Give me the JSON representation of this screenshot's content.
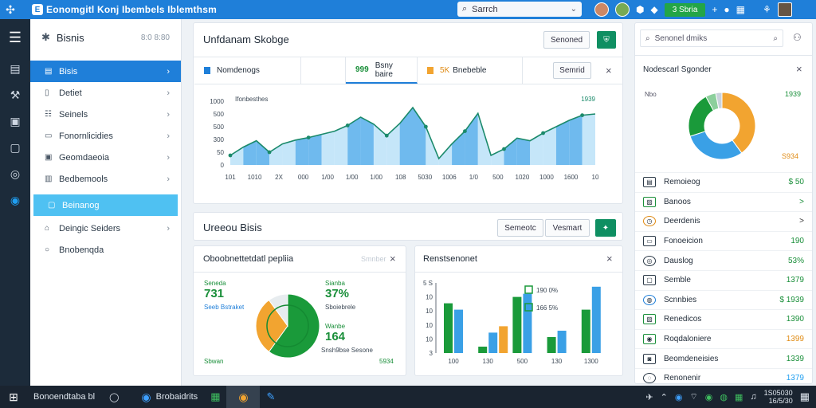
{
  "titlebar": {
    "badge": "E",
    "title": "Eonomgitl Konj Ibembels Iblemthsm",
    "search_value": "Sarrch"
  },
  "topbar": {
    "green_button": "3 Sbria"
  },
  "sidebar": {
    "title": "Bisnis",
    "count": "8:0 8:80",
    "items": [
      {
        "label": "Bisis"
      },
      {
        "label": "Detiet"
      },
      {
        "label": "Seinels"
      },
      {
        "label": "Fonornlicidies"
      },
      {
        "label": "Geomdaeoia"
      },
      {
        "label": "Bedbemools"
      },
      {
        "label": "Beinanog"
      },
      {
        "label": "Deingic Seiders"
      },
      {
        "label": "Bnobenqda"
      }
    ]
  },
  "panel_top": {
    "title": "Unfdanam Skobge",
    "btn_label": "Senoned",
    "tabs": [
      {
        "label": "Nomdenogs"
      },
      {
        "label": "Bsny baire",
        "prefix": "999"
      },
      {
        "label": "Bnebeble",
        "prefix": "5K"
      }
    ],
    "tab_button": "Semrid"
  },
  "main_chart": {
    "chart_data": {
      "type": "line",
      "annotation_left": "Ifonbesthes",
      "annotation_right": "1939",
      "y_ticks": [
        "1000",
        "500",
        "500",
        "300",
        "50",
        "0"
      ],
      "x_ticks": [
        "101",
        "1010",
        "2X",
        "000",
        "1/00",
        "1/00",
        "1/00",
        "108",
        "5030",
        "1006",
        "1/0",
        "500",
        "1020",
        "1000",
        "1600",
        "10"
      ],
      "ylim": [
        0,
        1000
      ],
      "series": [
        {
          "values": [
            150,
            280,
            380,
            200,
            330,
            390,
            430,
            480,
            530,
            620,
            750,
            640,
            460,
            650,
            900,
            600,
            100,
            330,
            530,
            810,
            150,
            250,
            420,
            380,
            500,
            600,
            700,
            780,
            800
          ]
        }
      ]
    }
  },
  "panel_mid": {
    "title": "Ureeou Bisis",
    "btn1": "Semeotc",
    "btn2": "Vesmart"
  },
  "panel_pie": {
    "title": "Oboobnettetdatl pepliia",
    "header_right": "Smnber",
    "stat1_label": "Seneda",
    "stat1_value": "731",
    "stat1_sub": "Seeb Bstraket",
    "stat2_label": "Sianba",
    "stat2_value": "37%",
    "stat2_sub": "Sboiebrele",
    "stat3_label": "Wanbe",
    "stat3_value": "164",
    "stat3_sub": "Snsh9bse Sesone",
    "foot_left": "Sbwan",
    "foot_right": "5934",
    "chart_data": {
      "type": "pie",
      "values": [
        60,
        30,
        10
      ]
    }
  },
  "panel_bar": {
    "title": "Renstsenonet",
    "legend": [
      "190 0%",
      "166 5%"
    ],
    "chart_data": {
      "type": "bar",
      "y_ticks": [
        "5 S",
        "10",
        "10",
        "10",
        "10",
        "3"
      ],
      "x_ticks": [
        "100",
        "130",
        "500",
        "130",
        "1300"
      ],
      "categories": [
        "100",
        "130",
        "500",
        "130",
        "1300"
      ],
      "series": [
        {
          "values": [
            78,
            10,
            88,
            25,
            68
          ]
        },
        {
          "values": [
            68,
            32,
            93,
            35,
            104
          ]
        },
        {
          "values": [
            0,
            42,
            0,
            0,
            0
          ]
        }
      ]
    }
  },
  "right_panel": {
    "search_value": "Senonel dmiks",
    "title": "Nodescarl Sgonder",
    "donut_top_left": "Nbo",
    "donut_top_right": "1939",
    "donut_bottom_right": "S934",
    "chart_data": {
      "type": "pie",
      "values": [
        40,
        30,
        22,
        5,
        3
      ]
    },
    "items": [
      {
        "label": "Remoieog",
        "value": "$ 50"
      },
      {
        "label": "Banoos",
        "value": ">"
      },
      {
        "label": "Deerdenis",
        "value": ">"
      },
      {
        "label": "Fonoeicion",
        "value": "190"
      },
      {
        "label": "Dauslog",
        "value": "53%"
      },
      {
        "label": "Semble",
        "value": "1379"
      },
      {
        "label": "Scnnbies",
        "value": "$ 1939"
      },
      {
        "label": "Renedicos",
        "value": "1390"
      },
      {
        "label": "Roqdaloniere",
        "value": "1399"
      },
      {
        "label": "Beomdeneisies",
        "value": "1339"
      },
      {
        "label": "Renonenir",
        "value": "1379"
      }
    ]
  },
  "taskbar": {
    "label": "Bonoendtaba bl",
    "app1": "Brobaidrits",
    "clock1": "1S05030",
    "clock2": "16/5/30"
  },
  "colors": {
    "accent": "#1f7fd9",
    "green": "#1a8f3a",
    "orange": "#f2a430",
    "light_blue": "#4fc1f2"
  }
}
